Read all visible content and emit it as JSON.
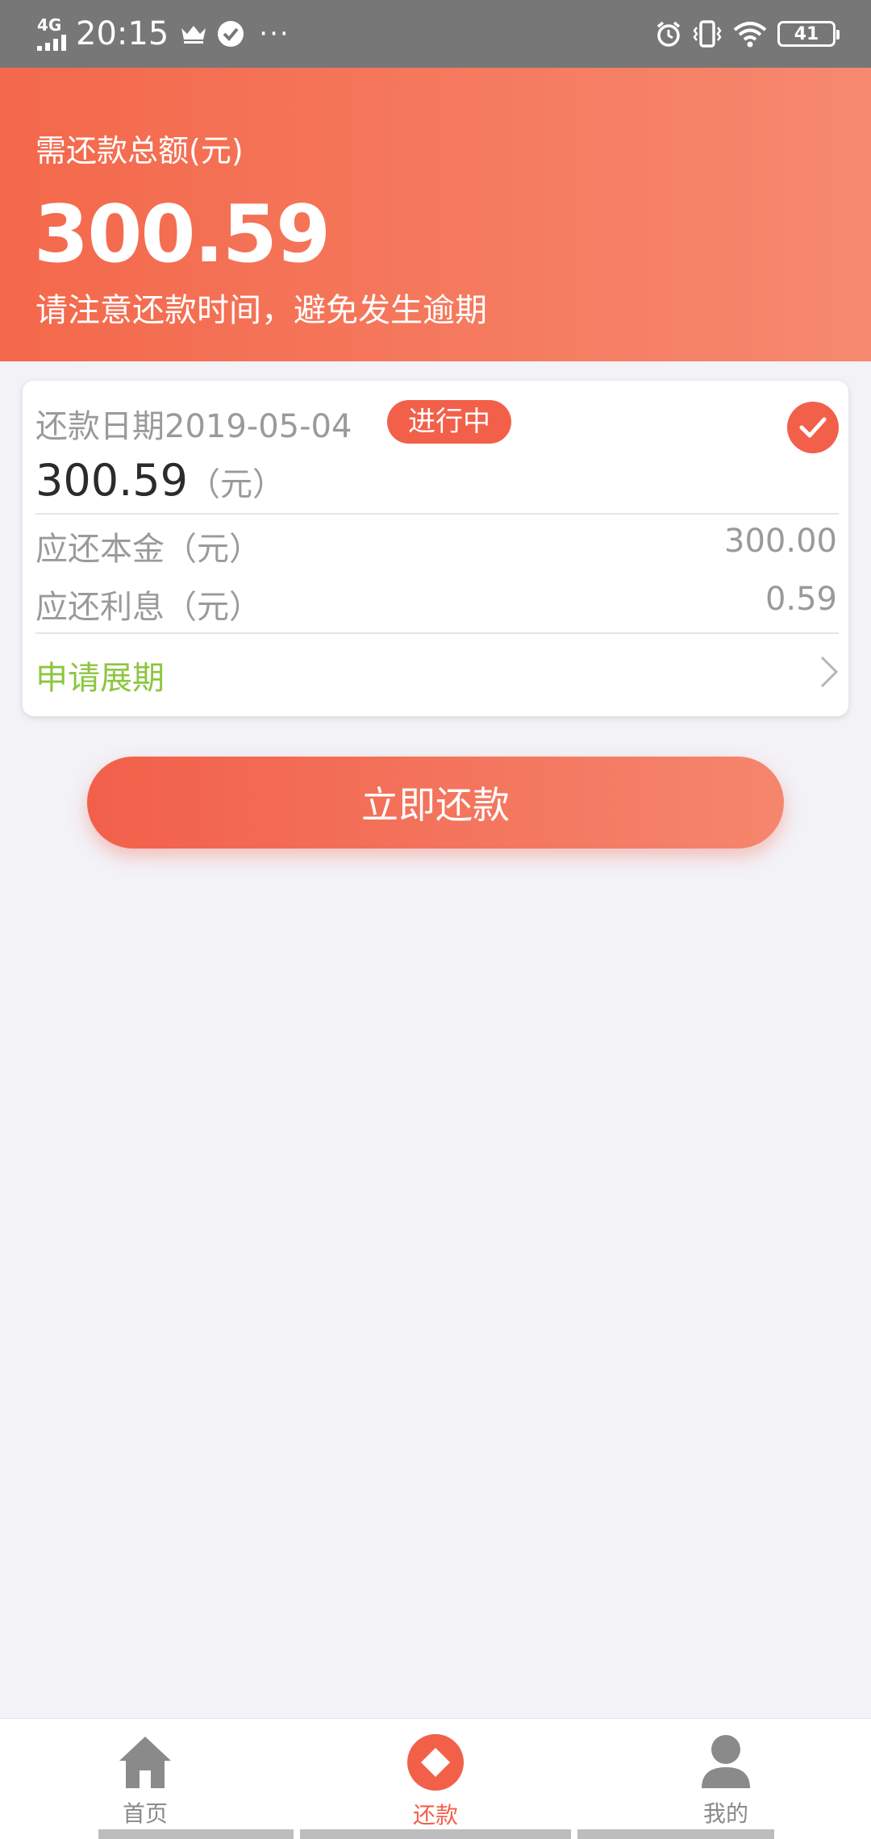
{
  "status_bar": {
    "network": "4G",
    "time": "20:15",
    "battery": "41",
    "more": "···"
  },
  "header": {
    "label": "需还款总额(元)",
    "amount": "300.59",
    "note": "请注意还款时间，避免发生逾期"
  },
  "card": {
    "date": "还款日期2019-05-04",
    "status": "进行中",
    "amount": "300.59",
    "amount_unit": "（元）",
    "rows": [
      {
        "label": "应还本金（元）",
        "value": "300.00"
      },
      {
        "label": "应还利息（元）",
        "value": "0.59"
      }
    ],
    "extend_label": "申请展期"
  },
  "pay_button": {
    "label": "立即还款"
  },
  "bottom_nav": {
    "items": [
      {
        "label": "首页",
        "icon": "home-icon",
        "active": false
      },
      {
        "label": "还款",
        "icon": "repay-icon",
        "active": true
      },
      {
        "label": "我的",
        "icon": "user-icon",
        "active": false
      }
    ]
  },
  "colors": {
    "accent": "#f2604a",
    "header_start": "#f4684b",
    "header_end": "#f6896f",
    "link_green": "#8cc63f",
    "status_bar": "#777777",
    "background": "#f3f2f7"
  }
}
